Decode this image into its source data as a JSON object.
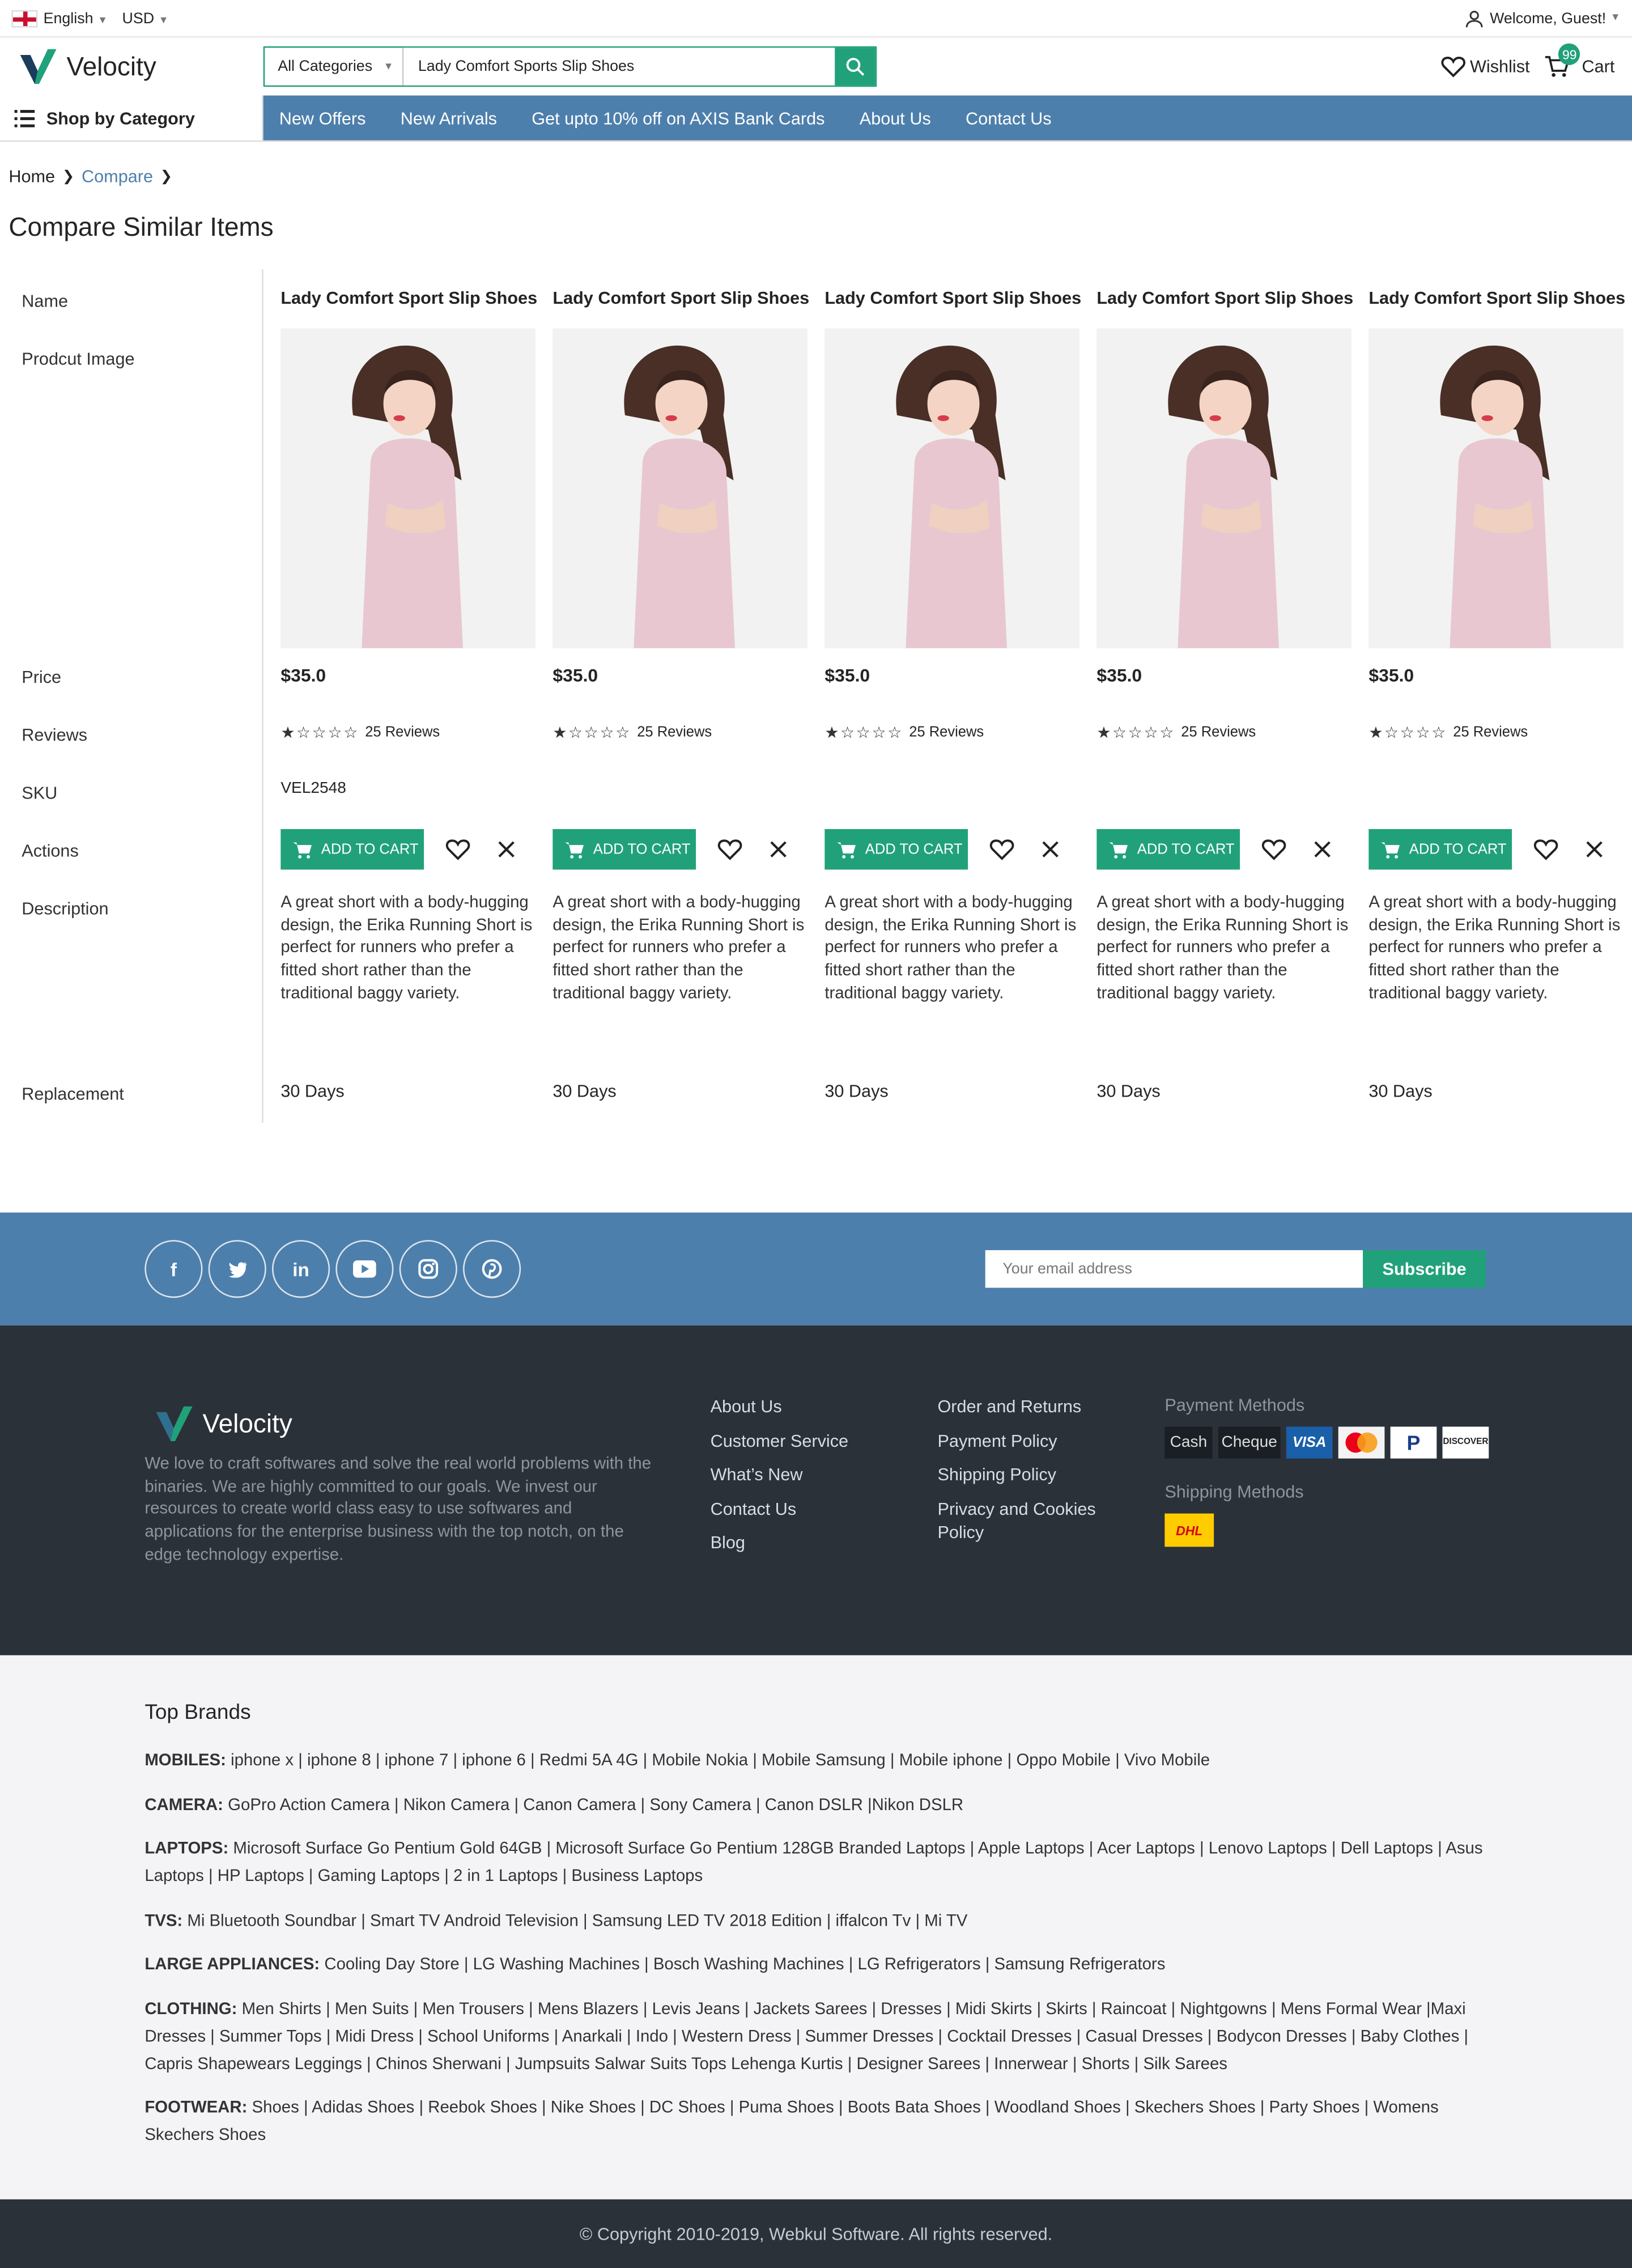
{
  "topbar": {
    "language": "English",
    "currency": "USD",
    "welcome": "Welcome, Guest!"
  },
  "header": {
    "logo_text": "Velocity",
    "category_select": "All Categories",
    "search_value": "Lady Comfort Sports Slip Shoes",
    "wishlist_label": "Wishlist",
    "cart_label": "Cart",
    "cart_count": "99"
  },
  "nav": {
    "shop_by_category": "Shop by Category",
    "links": [
      "New Offers",
      "New Arrivals",
      "Get upto 10% off on AXIS Bank Cards",
      "About Us",
      "Contact Us"
    ]
  },
  "breadcrumb": {
    "home": "Home",
    "compare": "Compare"
  },
  "page_title": "Compare Similar Items",
  "row_labels": {
    "name": "Name",
    "image": "Prodcut Image",
    "price": "Price",
    "reviews": "Reviews",
    "sku": "SKU",
    "actions": "Actions",
    "description": "Description",
    "replacement": "Replacement"
  },
  "products": [
    {
      "name": "Lady Comfort Sport Slip Shoes",
      "price": "$35.0",
      "rating": 1,
      "reviews": "25 Reviews",
      "sku": "VEL2548",
      "add_to_cart": "ADD TO CART",
      "description": "A great short with a body-hugging design, the Erika Running Short is perfect for runners who prefer a fitted short rather than the traditional baggy variety.",
      "replacement": "30 Days"
    },
    {
      "name": "Lady Comfort Sport Slip Shoes",
      "price": "$35.0",
      "rating": 1,
      "reviews": "25 Reviews",
      "sku": "",
      "add_to_cart": "ADD TO CART",
      "description": "A great short with a body-hugging design, the Erika Running Short is perfect for runners who prefer a fitted short rather than the traditional baggy variety.",
      "replacement": "30 Days"
    },
    {
      "name": "Lady Comfort Sport Slip Shoes",
      "price": "$35.0",
      "rating": 1,
      "reviews": "25 Reviews",
      "sku": "",
      "add_to_cart": "ADD TO CART",
      "description": "A great short with a body-hugging design, the Erika Running Short is perfect for runners who prefer a fitted short rather than the traditional baggy variety.",
      "replacement": "30 Days"
    },
    {
      "name": "Lady Comfort Sport Slip Shoes",
      "price": "$35.0",
      "rating": 1,
      "reviews": "25 Reviews",
      "sku": "",
      "add_to_cart": "ADD TO CART",
      "description": "A great short with a body-hugging design, the Erika Running Short is perfect for runners who prefer a fitted short rather than the traditional baggy variety.",
      "replacement": "30 Days"
    },
    {
      "name": "Lady Comfort Sport Slip Shoes",
      "price": "$35.0",
      "rating": 1,
      "reviews": "25 Reviews",
      "sku": "",
      "add_to_cart": "ADD TO CART",
      "description": "A great short with a body-hugging design, the Erika Running Short is perfect for runners who prefer a fitted short rather than the traditional baggy variety.",
      "replacement": "30 Days"
    }
  ],
  "subscribe": {
    "social_icons": [
      "facebook-icon",
      "twitter-icon",
      "linkedin-icon",
      "youtube-icon",
      "instagram-icon",
      "pinterest-icon"
    ],
    "email_placeholder": "Your email address",
    "button": "Subscribe"
  },
  "footer": {
    "logo_text": "Velocity",
    "description": "We love to craft softwares and solve the real world problems with the binaries. We are highly committed to our goals. We invest our resources to create world class easy to use softwares and applications for the enterprise business with the top notch, on the edge technology expertise.",
    "col1": [
      "About Us",
      "Customer Service",
      "What’s New",
      "Contact Us",
      "Blog"
    ],
    "col2": [
      "Order and Returns",
      "Payment Policy",
      "Shipping Policy",
      "Privacy and Cookies Policy"
    ],
    "payment_title": "Payment Methods",
    "payment_methods": [
      "Cash",
      "Cheque",
      "VISA",
      "MasterCard",
      "P",
      "DISCOVER"
    ],
    "shipping_title": "Shipping Methods",
    "shipping_methods": [
      "DHL"
    ]
  },
  "brands": {
    "title": "Top Brands",
    "groups": [
      {
        "label": "MOBILES:",
        "items": "iphone x | iphone 8 | iphone 7 | iphone 6 | Redmi 5A 4G | Mobile Nokia | Mobile Samsung | Mobile iphone | Oppo Mobile | Vivo Mobile"
      },
      {
        "label": "CAMERA:",
        "items": "GoPro Action Camera | Nikon Camera | Canon Camera | Sony Camera | Canon DSLR |Nikon DSLR"
      },
      {
        "label": "LAPTOPS:",
        "items": "Microsoft Surface Go Pentium Gold 64GB | Microsoft Surface Go Pentium 128GB Branded Laptops | Apple Laptops | Acer Laptops | Lenovo Laptops | Dell Laptops | Asus Laptops | HP Laptops | Gaming Laptops | 2 in 1 Laptops | Business Laptops"
      },
      {
        "label": "TVS:",
        "items": "Mi Bluetooth Soundbar | Smart TV Android Television | Samsung LED TV 2018 Edition | iffalcon Tv | Mi TV"
      },
      {
        "label": "LARGE APPLIANCES:",
        "items": "Cooling Day Store | LG Washing Machines | Bosch Washing Machines | LG Refrigerators | Samsung Refrigerators"
      },
      {
        "label": "CLOTHING:",
        "items": "Men Shirts | Men Suits | Men Trousers | Mens Blazers | Levis Jeans | Jackets Sarees | Dresses | Midi Skirts | Skirts | Raincoat | Nightgowns | Mens Formal Wear |Maxi Dresses | Summer Tops | Midi Dress | School Uniforms | Anarkali | Indo | Western Dress | Summer Dresses | Cocktail Dresses | Casual Dresses | Bodycon Dresses | Baby Clothes | Capris Shapewears Leggings | Chinos Sherwani | Jumpsuits Salwar Suits Tops Lehenga Kurtis | Designer Sarees | Innerwear | Shorts | Silk Sarees"
      },
      {
        "label": "FOOTWEAR:",
        "items": "Shoes | Adidas Shoes | Reebok Shoes | Nike Shoes | DC Shoes | Puma Shoes | Boots Bata Shoes | Woodland Shoes | Skechers Shoes | Party Shoes | Womens Skechers Shoes"
      }
    ]
  },
  "copyright": "© Copyright 2010-2019, Webkul Software. All rights reserved.",
  "colors": {
    "accent": "#21a179",
    "nav_blue": "#4d7fac",
    "footer_dark": "#2b3139"
  }
}
